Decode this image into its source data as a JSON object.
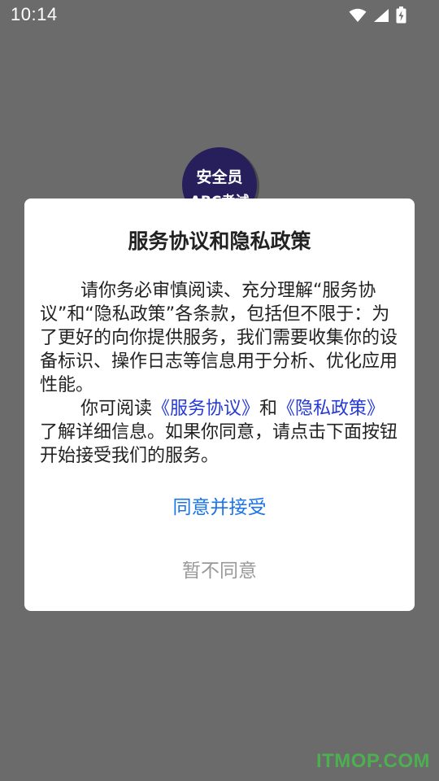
{
  "status_bar": {
    "time": "10:14",
    "icons": [
      "wifi-icon",
      "signal-icon",
      "battery-charging-icon"
    ]
  },
  "app_logo": {
    "line1": "安全员",
    "line2": "ABC考试"
  },
  "dialog": {
    "title": "服务协议和隐私政策",
    "paragraph1": "请你务必审慎阅读、充分理解“服务协议”和“隐私政策”各条款，包括但不限于：为了更好的向你提供服务，我们需要收集你的设备标识、操作日志等信息用于分析、优化应用性能。",
    "paragraph2_prefix": "你可阅读",
    "service_link": "《服务协议》",
    "and": "和",
    "privacy_link": "《隐私政策》",
    "paragraph2_suffix": "了解详细信息。如果你同意，请点击下面按钮开始接受我们的服务。",
    "agree_label": "同意并接受",
    "disagree_label": "暂不同意"
  },
  "watermark": "ITMOP.COM",
  "colors": {
    "overlay": "#6b6b6b",
    "link": "#2439d6",
    "primary_button": "#1a73e8",
    "secondary_button": "#999999",
    "watermark": "#4caf50"
  }
}
